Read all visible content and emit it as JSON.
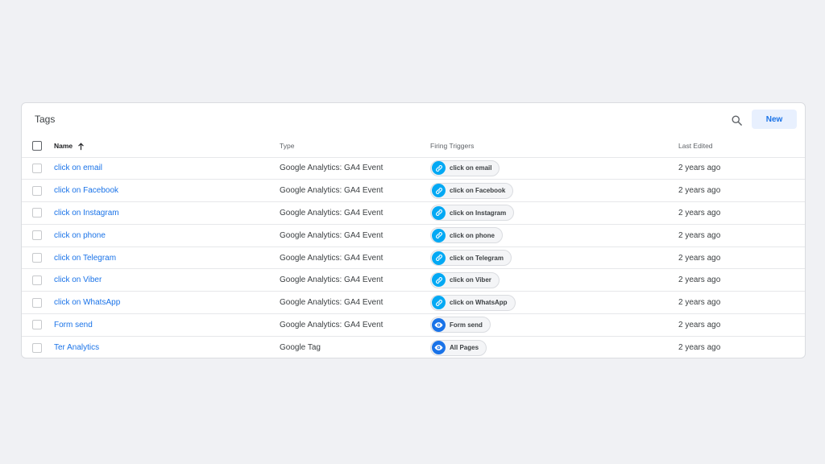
{
  "panel": {
    "title": "Tags",
    "new_label": "New",
    "search_icon": "search-icon"
  },
  "columns": {
    "name": "Name",
    "type": "Type",
    "triggers": "Firing Triggers",
    "edited": "Last Edited"
  },
  "colors": {
    "link": "#1a73e8",
    "link_trigger_icon": "#03a9f4",
    "pageview_trigger_icon": "#1a73e8"
  },
  "rows": [
    {
      "name": "click on email",
      "type": "Google Analytics: GA4 Event",
      "trigger": "click on email",
      "trigger_icon": "link-icon",
      "edited": "2 years ago"
    },
    {
      "name": "click on Facebook",
      "type": "Google Analytics: GA4 Event",
      "trigger": "click on Facebook",
      "trigger_icon": "link-icon",
      "edited": "2 years ago"
    },
    {
      "name": "click on Instagram",
      "type": "Google Analytics: GA4 Event",
      "trigger": "click on Instagram",
      "trigger_icon": "link-icon",
      "edited": "2 years ago"
    },
    {
      "name": "click on phone",
      "type": "Google Analytics: GA4 Event",
      "trigger": "click on phone",
      "trigger_icon": "link-icon",
      "edited": "2 years ago"
    },
    {
      "name": "click on Telegram",
      "type": "Google Analytics: GA4 Event",
      "trigger": "click on Telegram",
      "trigger_icon": "link-icon",
      "edited": "2 years ago"
    },
    {
      "name": "click on Viber",
      "type": "Google Analytics: GA4 Event",
      "trigger": "click on Viber",
      "trigger_icon": "link-icon",
      "edited": "2 years ago"
    },
    {
      "name": "click on WhatsApp",
      "type": "Google Analytics: GA4 Event",
      "trigger": "click on WhatsApp",
      "trigger_icon": "link-icon",
      "edited": "2 years ago"
    },
    {
      "name": "Form send",
      "type": "Google Analytics: GA4 Event",
      "trigger": "Form send",
      "trigger_icon": "eye-icon",
      "edited": "2 years ago"
    },
    {
      "name": "Ter Analytics",
      "type": "Google Tag",
      "trigger": "All Pages",
      "trigger_icon": "eye-icon",
      "edited": "2 years ago"
    }
  ]
}
